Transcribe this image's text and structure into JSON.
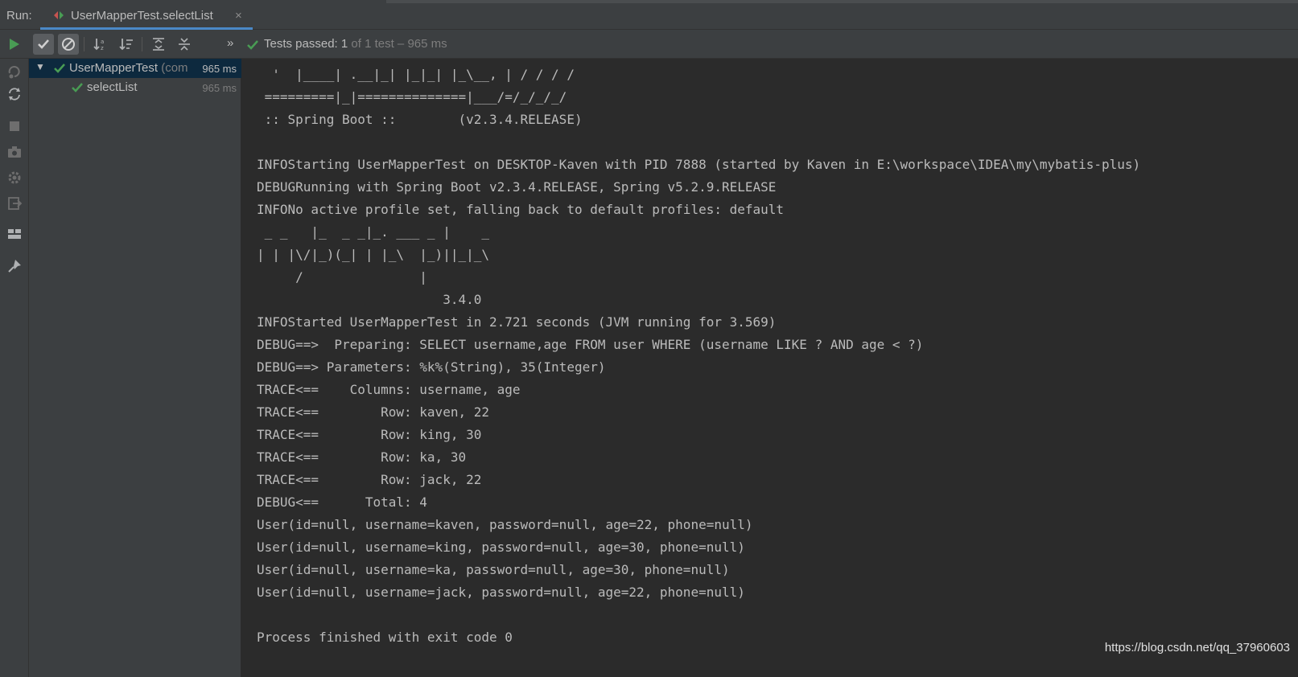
{
  "run_panel": {
    "label": "Run:",
    "tab_title": "UserMapperTest.selectList",
    "tab_close": "×"
  },
  "toolbar": {
    "overflow": "»",
    "status_passed": "Tests passed: ",
    "status_count": "1",
    "status_rest": " of 1 test – 965 ms"
  },
  "tree": {
    "root_label": "UserMapperTest",
    "root_suffix": " (com",
    "root_time": "965 ms",
    "child_label": "selectList",
    "child_time": "965 ms"
  },
  "console_lines": [
    "  '  |____| .__|_| |_|_| |_\\__, | / / / /",
    " =========|_|==============|___/=/_/_/_/",
    " :: Spring Boot ::        (v2.3.4.RELEASE)",
    "",
    "INFOStarting UserMapperTest on DESKTOP-Kaven with PID 7888 (started by Kaven in E:\\workspace\\IDEA\\my\\mybatis-plus)",
    "DEBUGRunning with Spring Boot v2.3.4.RELEASE, Spring v5.2.9.RELEASE",
    "INFONo active profile set, falling back to default profiles: default",
    " _ _   |_  _ _|_. ___ _ |    _",
    "| | |\\/|_)(_| | |_\\  |_)||_|_\\",
    "     /               |",
    "                        3.4.0",
    "INFOStarted UserMapperTest in 2.721 seconds (JVM running for 3.569)",
    "DEBUG==>  Preparing: SELECT username,age FROM user WHERE (username LIKE ? AND age < ?)",
    "DEBUG==> Parameters: %k%(String), 35(Integer)",
    "TRACE<==    Columns: username, age",
    "TRACE<==        Row: kaven, 22",
    "TRACE<==        Row: king, 30",
    "TRACE<==        Row: ka, 30",
    "TRACE<==        Row: jack, 22",
    "DEBUG<==      Total: 4",
    "User(id=null, username=kaven, password=null, age=22, phone=null)",
    "User(id=null, username=king, password=null, age=30, phone=null)",
    "User(id=null, username=ka, password=null, age=30, phone=null)",
    "User(id=null, username=jack, password=null, age=22, phone=null)",
    "",
    "Process finished with exit code 0"
  ],
  "watermark": "https://blog.csdn.net/qq_37960603",
  "colors": {
    "panel_bg": "#3c3f41",
    "console_bg": "#2b2b2b",
    "text": "#bbbbbb",
    "pass_green": "#499c54",
    "selection": "#0d293e",
    "tab_underline": "#4a88c7"
  }
}
